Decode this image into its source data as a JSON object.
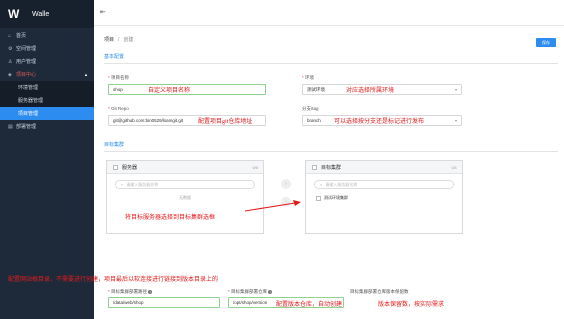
{
  "app": {
    "name": "Walle"
  },
  "sidebar": {
    "items": [
      {
        "label": "首页",
        "icon": "home-icon"
      },
      {
        "label": "空间管理",
        "icon": "gear-icon"
      },
      {
        "label": "用户管理",
        "icon": "user-icon"
      },
      {
        "label": "项目中心",
        "icon": "layers-icon"
      }
    ],
    "sub_items": [
      {
        "label": "环境管理"
      },
      {
        "label": "服务器管理"
      },
      {
        "label": "项目管理"
      }
    ],
    "last_item": {
      "label": "部署管理",
      "icon": "deploy-icon"
    }
  },
  "breadcrumb": {
    "parent": "项目",
    "current": "创建"
  },
  "toolbar": {
    "save_label": "保存"
  },
  "basic": {
    "title": "基本配置",
    "project_name": {
      "label": "项目名称",
      "value": "shop"
    },
    "env": {
      "label": "环境",
      "value": "测试环境"
    },
    "git_repo": {
      "label": "Git Repo",
      "value": "git@github.com:bin0529/lsamgit.git"
    },
    "branch": {
      "label": "分支/tag",
      "value": "branch"
    }
  },
  "targets": {
    "title": "目标集群",
    "source_panel": {
      "title": "服务器",
      "count": "0/0",
      "search_placeholder": "请输入服务器名称",
      "empty_text": "无数据"
    },
    "target_panel": {
      "title": "目标集群",
      "count": "0/1",
      "search_placeholder": "请输入服务器名称",
      "item": "测试环境集群"
    }
  },
  "deploy": {
    "webroot": {
      "label": "目标集群部署路径",
      "value": "/data/web/shop"
    },
    "repo_path": {
      "label": "目标集群部署仓库",
      "value": "/opt/shop/version"
    },
    "keep_versions": {
      "label": "目标集群部署仓库版本保留数"
    }
  },
  "annotations": {
    "project_name": "自定义项目名称",
    "env": "对应选择所属环境",
    "git": "配置项目git仓库地址",
    "branch": "可以选择按分支还是标记进行发布",
    "transfer": "将目标服务器选择到目标集群选框",
    "webroot": "配置网站根目录，不需要进行创建，项目最后以软连接进行链接到版本目录上的",
    "repo": "配置版本仓库，自动创建",
    "keep": "版本保留数，按实际需求"
  },
  "colors": {
    "sidebar": "#1e2a3a",
    "accent": "#2d8cf0",
    "annotation": "#e21b1b"
  }
}
